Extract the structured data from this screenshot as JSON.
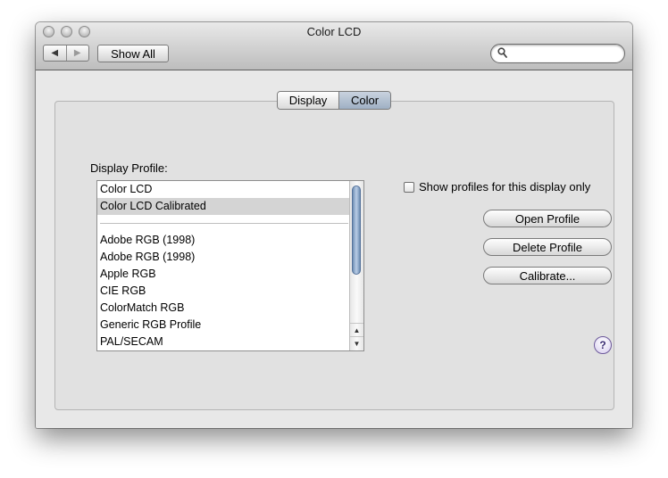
{
  "window": {
    "title": "Color LCD"
  },
  "toolbar": {
    "back_icon": "◀",
    "forward_icon": "▶",
    "show_all_label": "Show All",
    "search_value": ""
  },
  "tabs": [
    {
      "label": "Display",
      "selected": false
    },
    {
      "label": "Color",
      "selected": true
    }
  ],
  "display_profile": {
    "label": "Display Profile:",
    "items": [
      {
        "label": "Color LCD",
        "selected": false
      },
      {
        "label": "Color LCD Calibrated",
        "selected": true
      },
      {
        "label": "Adobe RGB (1998)",
        "selected": false
      },
      {
        "label": "Adobe RGB (1998)",
        "selected": false
      },
      {
        "label": "Apple RGB",
        "selected": false
      },
      {
        "label": "CIE RGB",
        "selected": false
      },
      {
        "label": "ColorMatch RGB",
        "selected": false
      },
      {
        "label": "Generic RGB Profile",
        "selected": false
      },
      {
        "label": "PAL/SECAM",
        "selected": false
      }
    ]
  },
  "options": {
    "show_profiles_label": "Show profiles for this display only",
    "show_profiles_checked": false
  },
  "buttons": {
    "open_profile": "Open Profile",
    "delete_profile": "Delete Profile",
    "calibrate": "Calibrate..."
  },
  "help": {
    "label": "?"
  },
  "scrollbar": {
    "up_icon": "▲",
    "down_icon": "▼"
  }
}
